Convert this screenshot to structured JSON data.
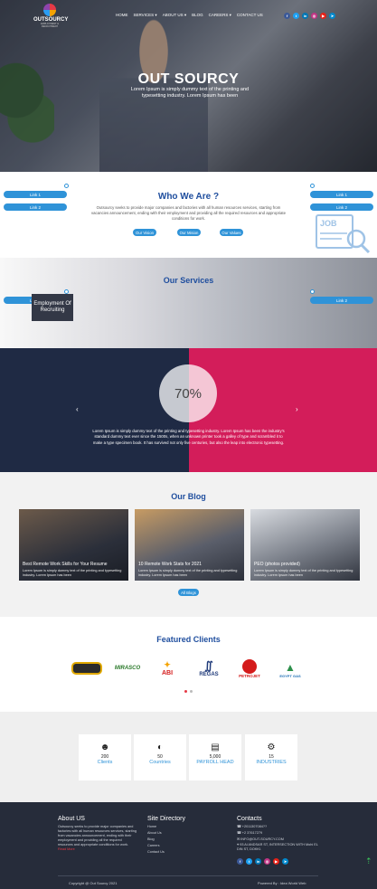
{
  "brand": {
    "name": "OUTSOURCY",
    "tagline": "EMPLOYMENT & RECRUITMENT"
  },
  "nav": [
    "HOME",
    "SERVICES ▾",
    "ABOUT US ▾",
    "BLOG",
    "CAREERS ▾",
    "CONTACT US"
  ],
  "social_icons": [
    {
      "icon": "facebook-icon",
      "glyph": "f",
      "color": "#3b5998"
    },
    {
      "icon": "twitter-icon",
      "glyph": "t",
      "color": "#1da1f2"
    },
    {
      "icon": "linkedin-icon",
      "glyph": "in",
      "color": "#0077b5"
    },
    {
      "icon": "instagram-icon",
      "glyph": "◎",
      "color": "#c13584"
    },
    {
      "icon": "youtube-icon",
      "glyph": "▶",
      "color": "#e62117"
    },
    {
      "icon": "telegram-icon",
      "glyph": "➤",
      "color": "#0088cc"
    }
  ],
  "hero": {
    "title": "OUT SOURCY",
    "subtitle": "Lorem Ipsum is simply dummy text of the printing and typesetting industry. Lorem Ipsum has been"
  },
  "side_links": {
    "link1": "Link 1",
    "link2": "Link 2"
  },
  "who": {
    "title": "Who We Are ?",
    "text": "Outsourcy seeks to provide major companies and factories with all human resources services, starting from vacancies announcement, ending with their employment and providing all the required resources and appropriate conditions for work.",
    "buttons": [
      "Our Vision",
      "Our Mision",
      "Our Values"
    ]
  },
  "services": {
    "title": "Our Services",
    "card": "Employment Of Recruiting"
  },
  "stats": {
    "percent": "70%",
    "quote": "Lorem Ipsum is simply dummy text of the printing and typesetting industry. Lorem Ipsum has been the industry's standard dummy text ever since the 1500s, when an unknown printer took a galley of type and scrambled it to make a type specimen book. It has survived not only five centuries, but also the leap into electronic typesetting.",
    "prev": "‹",
    "next": "›"
  },
  "blog": {
    "title": "Our Blog",
    "posts": [
      {
        "title": "Best Remote Work Skills for Your Resume",
        "desc": "Lorem Ipsum is simply dummy text of the printing and typesetting industry. Lorem Ipsum has been"
      },
      {
        "title": "10 Remote Work Stats for 2021",
        "desc": "Lorem Ipsum is simply dummy text of the printing and typesetting industry. Lorem Ipsum has been"
      },
      {
        "title": "PEO (photos provided)",
        "desc": "Lorem Ipsum is simply dummy text of the printing and typesetting industry. Lorem Ipsum has been"
      }
    ],
    "all_button": "All Blogs"
  },
  "clients": {
    "title": "Featured Clients",
    "logos": [
      "MIRASCO",
      "ABI",
      "REGAS",
      "PETROJET",
      "EGYPT GAS"
    ]
  },
  "counters": [
    {
      "icon": "people-icon",
      "glyph": "☻",
      "number": "200",
      "label": "Clients"
    },
    {
      "icon": "globe-icon",
      "glyph": "◐",
      "number": "50",
      "label": "Countries"
    },
    {
      "icon": "money-icon",
      "glyph": "▤",
      "number": "5,000",
      "label": "PAYROLL HEAD"
    },
    {
      "icon": "gears-icon",
      "glyph": "⚙",
      "number": "15",
      "label": "INDUSTRIES"
    }
  ],
  "footer": {
    "about_title": "About US",
    "about_text": "Outsourcy seeks to provide major companies and factories with all human resources services, starting from vacancies announcement, ending with their employment and providing all the required resources and appropriate conditions for work.",
    "read_more": "Read More",
    "directory_title": "Site Directory",
    "directory": [
      "Home",
      "About Us",
      "Blog",
      "Careers",
      "Contact Us"
    ],
    "contacts_title": "Contacts",
    "contacts": [
      "+2011307084??",
      "+2 37617279",
      "INFO@OUT-SOURCY.COM",
      "93 Al ANDSAR ST, INTERSECTION WITH Mohi EL DIN ST, DOKKI."
    ],
    "copyright": "Copyright @ Out Sourcy 2021",
    "powered": "Powered By : Idea World Web"
  }
}
